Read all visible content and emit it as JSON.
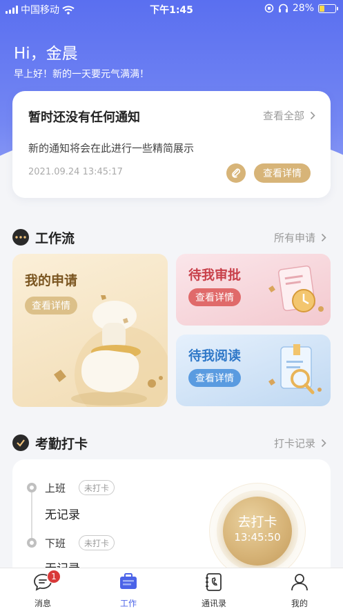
{
  "status_bar": {
    "carrier": "中国移动",
    "time": "下午1:45",
    "battery": "28%"
  },
  "header": {
    "greeting": "Hi，金晨",
    "subtitle": "早上好！新的一天要元气满满！"
  },
  "notice": {
    "title": "暂时还没有任何通知",
    "view_all": "查看全部",
    "body": "新的通知将会在此进行一些精简展示",
    "timestamp": "2021.09.24 13:45:17",
    "detail_label": "查看详情"
  },
  "workflow": {
    "title": "工作流",
    "link": "所有申请",
    "cards": [
      {
        "title": "我的申请",
        "button": "查看详情"
      },
      {
        "title": "待我审批",
        "button": "查看详情"
      },
      {
        "title": "待我阅读",
        "button": "查看详情"
      }
    ]
  },
  "attendance": {
    "title": "考勤打卡",
    "link": "打卡记录",
    "entries": [
      {
        "label": "上班",
        "tag": "未打卡",
        "record": "无记录"
      },
      {
        "label": "下班",
        "tag": "未打卡",
        "record": "无记录"
      }
    ],
    "clock_button": "去打卡",
    "clock_time": "13:45:50"
  },
  "tabbar": {
    "tabs": [
      {
        "label": "消息",
        "icon": "chat-icon",
        "badge": "1"
      },
      {
        "label": "工作",
        "icon": "briefcase-icon"
      },
      {
        "label": "通讯录",
        "icon": "contacts-book-icon"
      },
      {
        "label": "我的",
        "icon": "user-icon"
      }
    ],
    "active_color": "#4b63e8"
  },
  "colors": {
    "brand_blue": "#5a6ff0",
    "gold": "#d7b478",
    "approve_red": "#e06a6a",
    "read_blue": "#5a9be0",
    "badge_red": "#d93a3a"
  }
}
